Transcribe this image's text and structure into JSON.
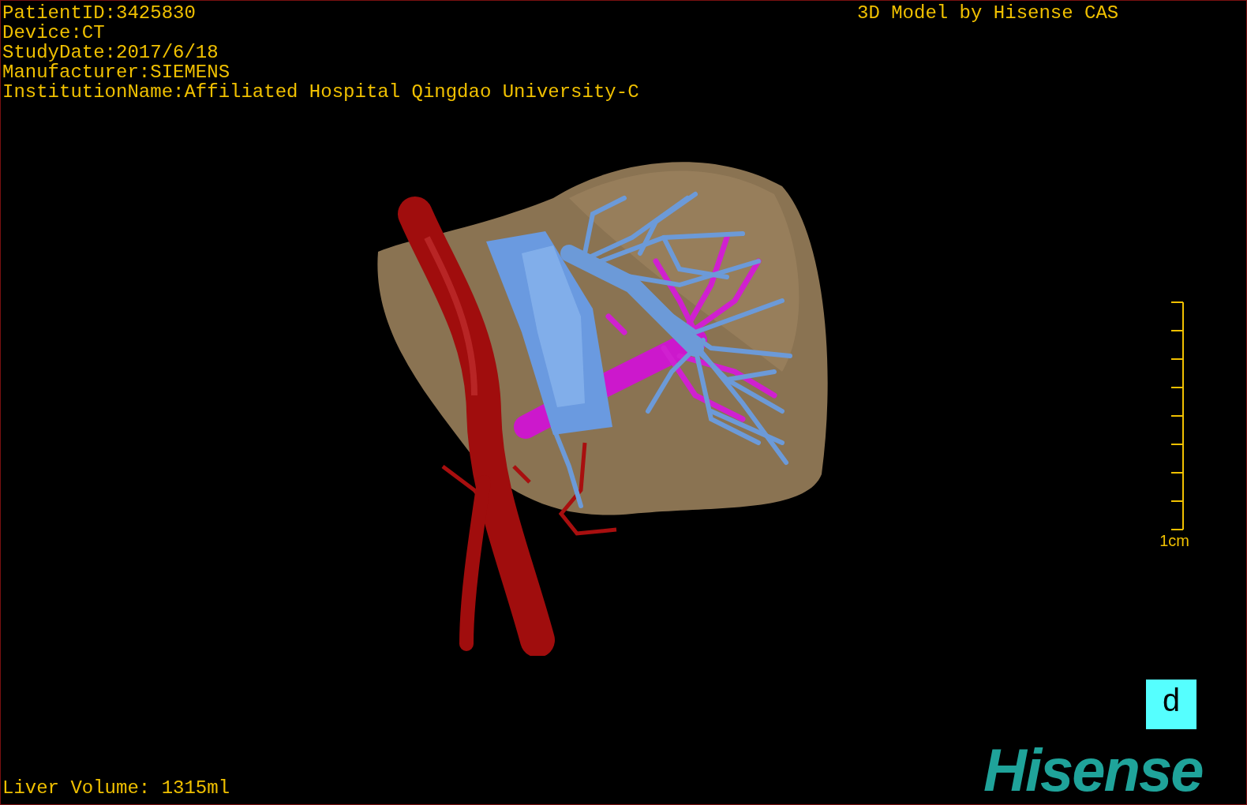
{
  "info_lines": [
    "PatientID:3425830",
    "Device:CT",
    "StudyDate:2017/6/18",
    "Manufacturer:SIEMENS",
    "InstitutionName:Affiliated Hospital Qingdao University-C"
  ],
  "model_credit": "3D Model by Hisense CAS",
  "scale_bar": {
    "label": "1cm"
  },
  "orientation_marker": "d",
  "liver_volume": "Liver Volume: 1315ml",
  "logo": "Hisense"
}
